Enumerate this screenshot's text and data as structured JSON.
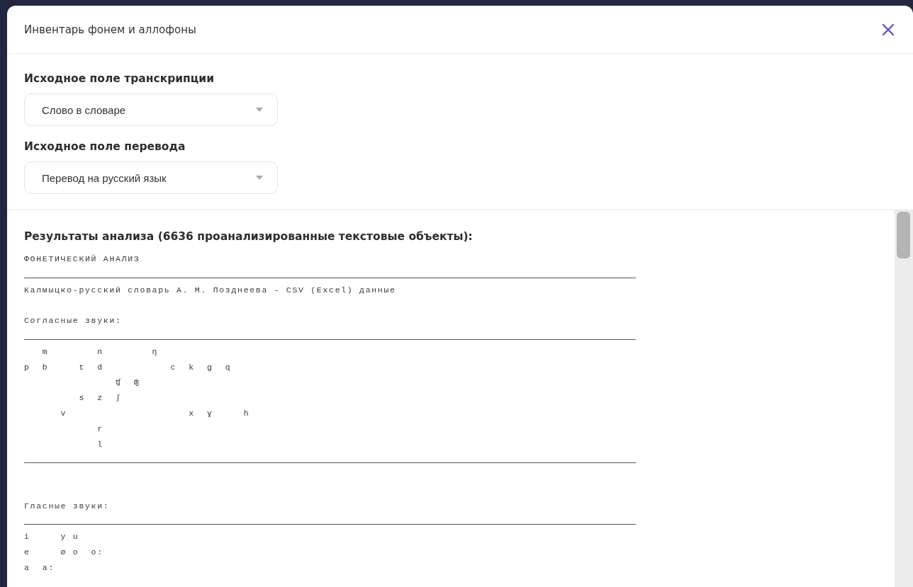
{
  "dialog": {
    "title": "Инвентарь фонем и аллофоны"
  },
  "fields": [
    {
      "label": "Исходное поле транскрипции",
      "value": "Слово в словаре"
    },
    {
      "label": "Исходное поле перевода",
      "value": "Перевод на русский язык"
    }
  ],
  "results": {
    "heading": "Результаты анализа (6636 проанализированные текстовые объекты):",
    "lines": [
      {
        "kind": "text",
        "text": "ФОНЕТИЧЕСКИЙ АНАЛИЗ"
      },
      {
        "kind": "rule"
      },
      {
        "kind": "text",
        "text": "Калмыцко-русский словарь А. М. Позднеева - CSV (Excel) данные"
      },
      {
        "kind": "blank"
      },
      {
        "kind": "text",
        "text": "Согласные звуки:"
      },
      {
        "kind": "rule"
      },
      {
        "kind": "symbols",
        "text": "   m        n        ŋ"
      },
      {
        "kind": "symbols",
        "text": "p  b     t  d           c  k  g  q"
      },
      {
        "kind": "symbols",
        "text": "               ʧ  ʤ"
      },
      {
        "kind": "symbols",
        "text": "         s  z  ʃ"
      },
      {
        "kind": "symbols",
        "text": "      v                    x  ɣ     h"
      },
      {
        "kind": "symbols",
        "text": "            r"
      },
      {
        "kind": "symbols",
        "text": "            l"
      },
      {
        "kind": "rule"
      },
      {
        "kind": "blank"
      },
      {
        "kind": "blank"
      },
      {
        "kind": "text",
        "text": "Гласные звуки:"
      },
      {
        "kind": "rule"
      },
      {
        "kind": "symbols",
        "text": "i     y u"
      },
      {
        "kind": "symbols",
        "text": "e     ø o  o:"
      },
      {
        "kind": "symbols",
        "text": "a  a:"
      }
    ]
  }
}
